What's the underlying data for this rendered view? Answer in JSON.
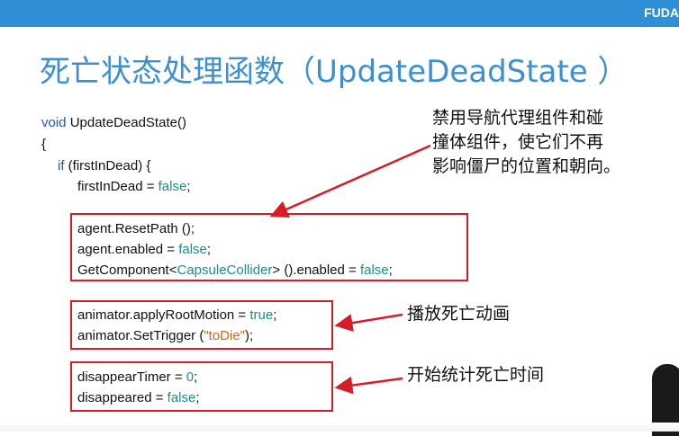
{
  "header": {
    "brand": "FUDA"
  },
  "slide": {
    "title": "死亡状态处理函数（UpdateDeadState  ）",
    "code": {
      "line1": "void UpdateDeadState()",
      "line2": "{",
      "line3": "if (firstInDead) {",
      "line4": "firstInDead = false;",
      "box1": [
        "agent.ResetPath ();",
        "agent.enabled = false;",
        "GetComponent<CapsuleCollider> ().enabled = false;"
      ],
      "box2": [
        "animator.applyRootMotion = true;",
        "animator.SetTrigger (\"toDie\");"
      ],
      "box3": [
        "disappearTimer = 0;",
        "disappeared = false;"
      ]
    },
    "notes": {
      "note1": [
        "禁用导航代理组件和碰",
        "撞体组件，使它们不再",
        "影响僵尸的位置和朝向。"
      ],
      "note2": "播放死亡动画",
      "note3": "开始统计死亡时间"
    }
  },
  "colors": {
    "header_bar": "#2f8fd6",
    "title": "#3d8fd0",
    "highlight_box": "#d41d27",
    "arrow": "#d41d27",
    "keyword": "#1f55c8",
    "literal": "#1a8f8a",
    "string": "#d0651d"
  }
}
